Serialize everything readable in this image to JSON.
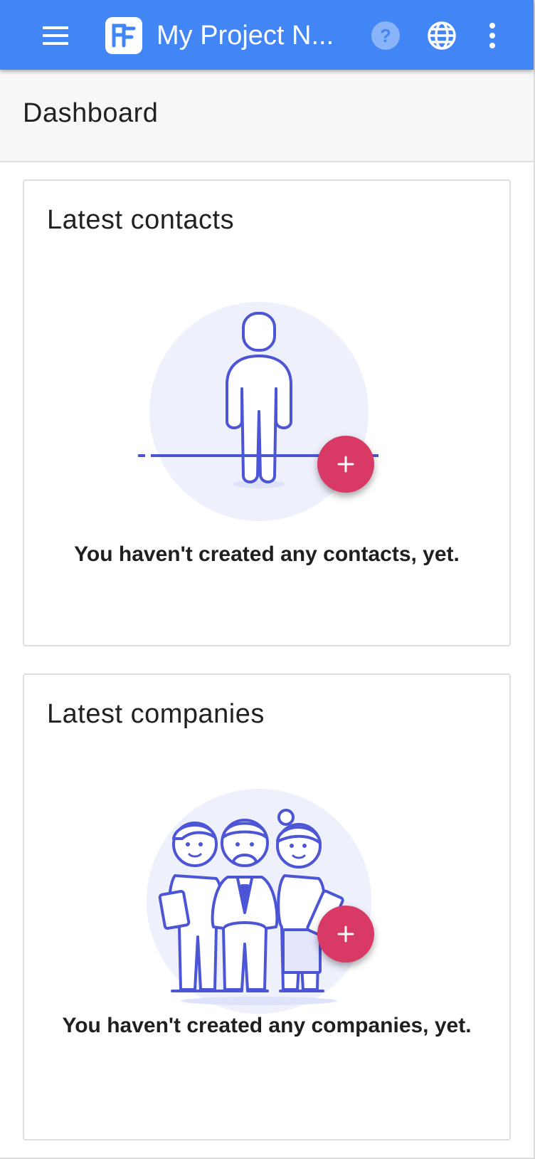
{
  "app": {
    "title": "My Project N...",
    "brand_color": "#4285f4",
    "icons": [
      "menu-icon",
      "app-logo-icon",
      "help-icon",
      "globe-icon",
      "more-vert-icon"
    ]
  },
  "page": {
    "title": "Dashboard"
  },
  "cards": [
    {
      "title": "Latest contacts",
      "empty_message": "You haven't created any contacts, yet.",
      "illustration": "person-illustration",
      "fab_icon": "add-icon"
    },
    {
      "title": "Latest companies",
      "empty_message": "You haven't created any companies, yet.",
      "illustration": "team-illustration",
      "fab_icon": "add-icon"
    }
  ],
  "colors": {
    "fab": "#d93965",
    "illustration_stroke": "#4b55d6",
    "illustration_bg": "#eef0fc"
  }
}
